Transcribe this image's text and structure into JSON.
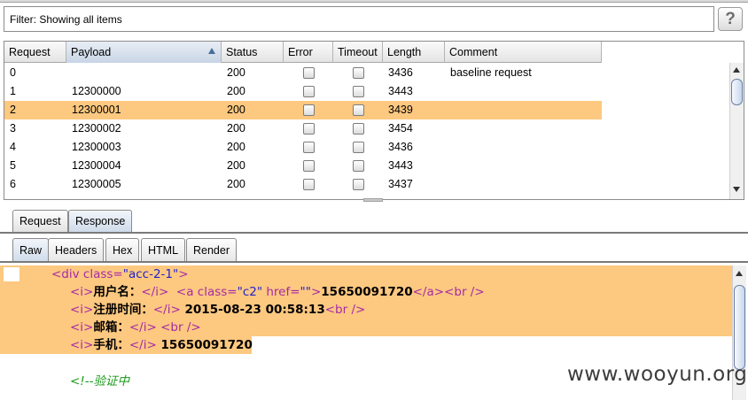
{
  "filter": {
    "text": "Filter: Showing all items",
    "help_label": "?"
  },
  "table": {
    "columns": [
      {
        "label": "Request"
      },
      {
        "label": "Payload"
      },
      {
        "label": "Status"
      },
      {
        "label": "Error"
      },
      {
        "label": "Timeout"
      },
      {
        "label": "Length"
      },
      {
        "label": "Comment"
      }
    ],
    "sorted_column": "Payload",
    "rows": [
      {
        "request": "0",
        "payload": "",
        "status": "200",
        "error": false,
        "timeout": false,
        "length": "3436",
        "comment": "baseline request",
        "selected": false
      },
      {
        "request": "1",
        "payload": "12300000",
        "status": "200",
        "error": false,
        "timeout": false,
        "length": "3443",
        "comment": "",
        "selected": false
      },
      {
        "request": "2",
        "payload": "12300001",
        "status": "200",
        "error": false,
        "timeout": false,
        "length": "3439",
        "comment": "",
        "selected": true
      },
      {
        "request": "3",
        "payload": "12300002",
        "status": "200",
        "error": false,
        "timeout": false,
        "length": "3454",
        "comment": "",
        "selected": false
      },
      {
        "request": "4",
        "payload": "12300003",
        "status": "200",
        "error": false,
        "timeout": false,
        "length": "3436",
        "comment": "",
        "selected": false
      },
      {
        "request": "5",
        "payload": "12300004",
        "status": "200",
        "error": false,
        "timeout": false,
        "length": "3443",
        "comment": "",
        "selected": false
      },
      {
        "request": "6",
        "payload": "12300005",
        "status": "200",
        "error": false,
        "timeout": false,
        "length": "3437",
        "comment": "",
        "selected": false
      }
    ]
  },
  "main_tabs": {
    "request": "Request",
    "response": "Response",
    "active": "Response"
  },
  "sub_tabs": {
    "raw": "Raw",
    "headers": "Headers",
    "hex": "Hex",
    "html": "HTML",
    "render": "Render",
    "active": "Raw"
  },
  "code": {
    "l1_open": "<div ",
    "l1_attr": "class=",
    "l1_val": "\"acc-2-1\"",
    "l1_close": ">",
    "l2_i_open": "<i>",
    "l2_label": "用户名：",
    "l2_i_close": "</i>",
    "l2_a_open": "<a ",
    "l2_a_attr1": "class=",
    "l2_a_val1": "\"c2\"",
    "l2_a_attr2": " href=",
    "l2_a_val2": "\"\"",
    "l2_a_gt": ">",
    "l2_username": "15650091720",
    "l2_a_close": "</a>",
    "l2_br": "<br />",
    "l3_i_open": "<i>",
    "l3_label": "注册时间：",
    "l3_i_close": "</i>",
    "l3_value": " 2015-08-23 00:58:13",
    "l3_br": "<br />",
    "l4_i_open": "<i>",
    "l4_label": "邮箱：",
    "l4_i_close": "</i>",
    "l4_br": "<br />",
    "l5_i_open": "<i>",
    "l5_label": "手机：",
    "l5_i_close": "</i>",
    "l5_value": " 15650091720",
    "l7_comment": "<!--验证中"
  },
  "watermark": "www.wooyun.org",
  "colors": {
    "highlight": "#fdc880",
    "tag": "#a52ba5",
    "string": "#2222cc",
    "comment": "#1a9a1a"
  }
}
